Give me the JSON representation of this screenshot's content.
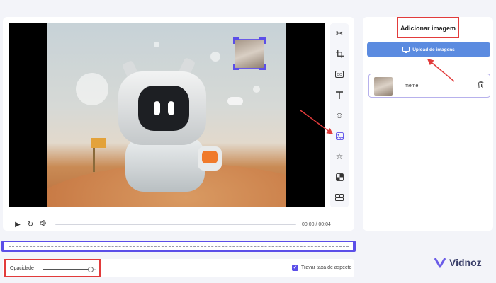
{
  "side_panel": {
    "title": "Adicionar imagem",
    "upload_label": "Upload de imagens",
    "image_item": {
      "name": "meme"
    }
  },
  "controls": {
    "time": "00:00 / 00:04"
  },
  "bottom_bar": {
    "opacity_label": "Opacidade",
    "opacity_value": 0.9,
    "aspect_label": "Travar taxa de aspecto",
    "aspect_checked": true
  },
  "tools": [
    "scissors-icon",
    "crop-icon",
    "subtitle-icon",
    "text-icon",
    "sticker-icon",
    "image-icon",
    "effects-icon",
    "filter-icon",
    "more-icon"
  ],
  "logo": {
    "text": "Vidnoz"
  },
  "colors": {
    "accent": "#5b4ee8",
    "highlight": "#e23b3b",
    "upload_button": "#5b8be0"
  }
}
